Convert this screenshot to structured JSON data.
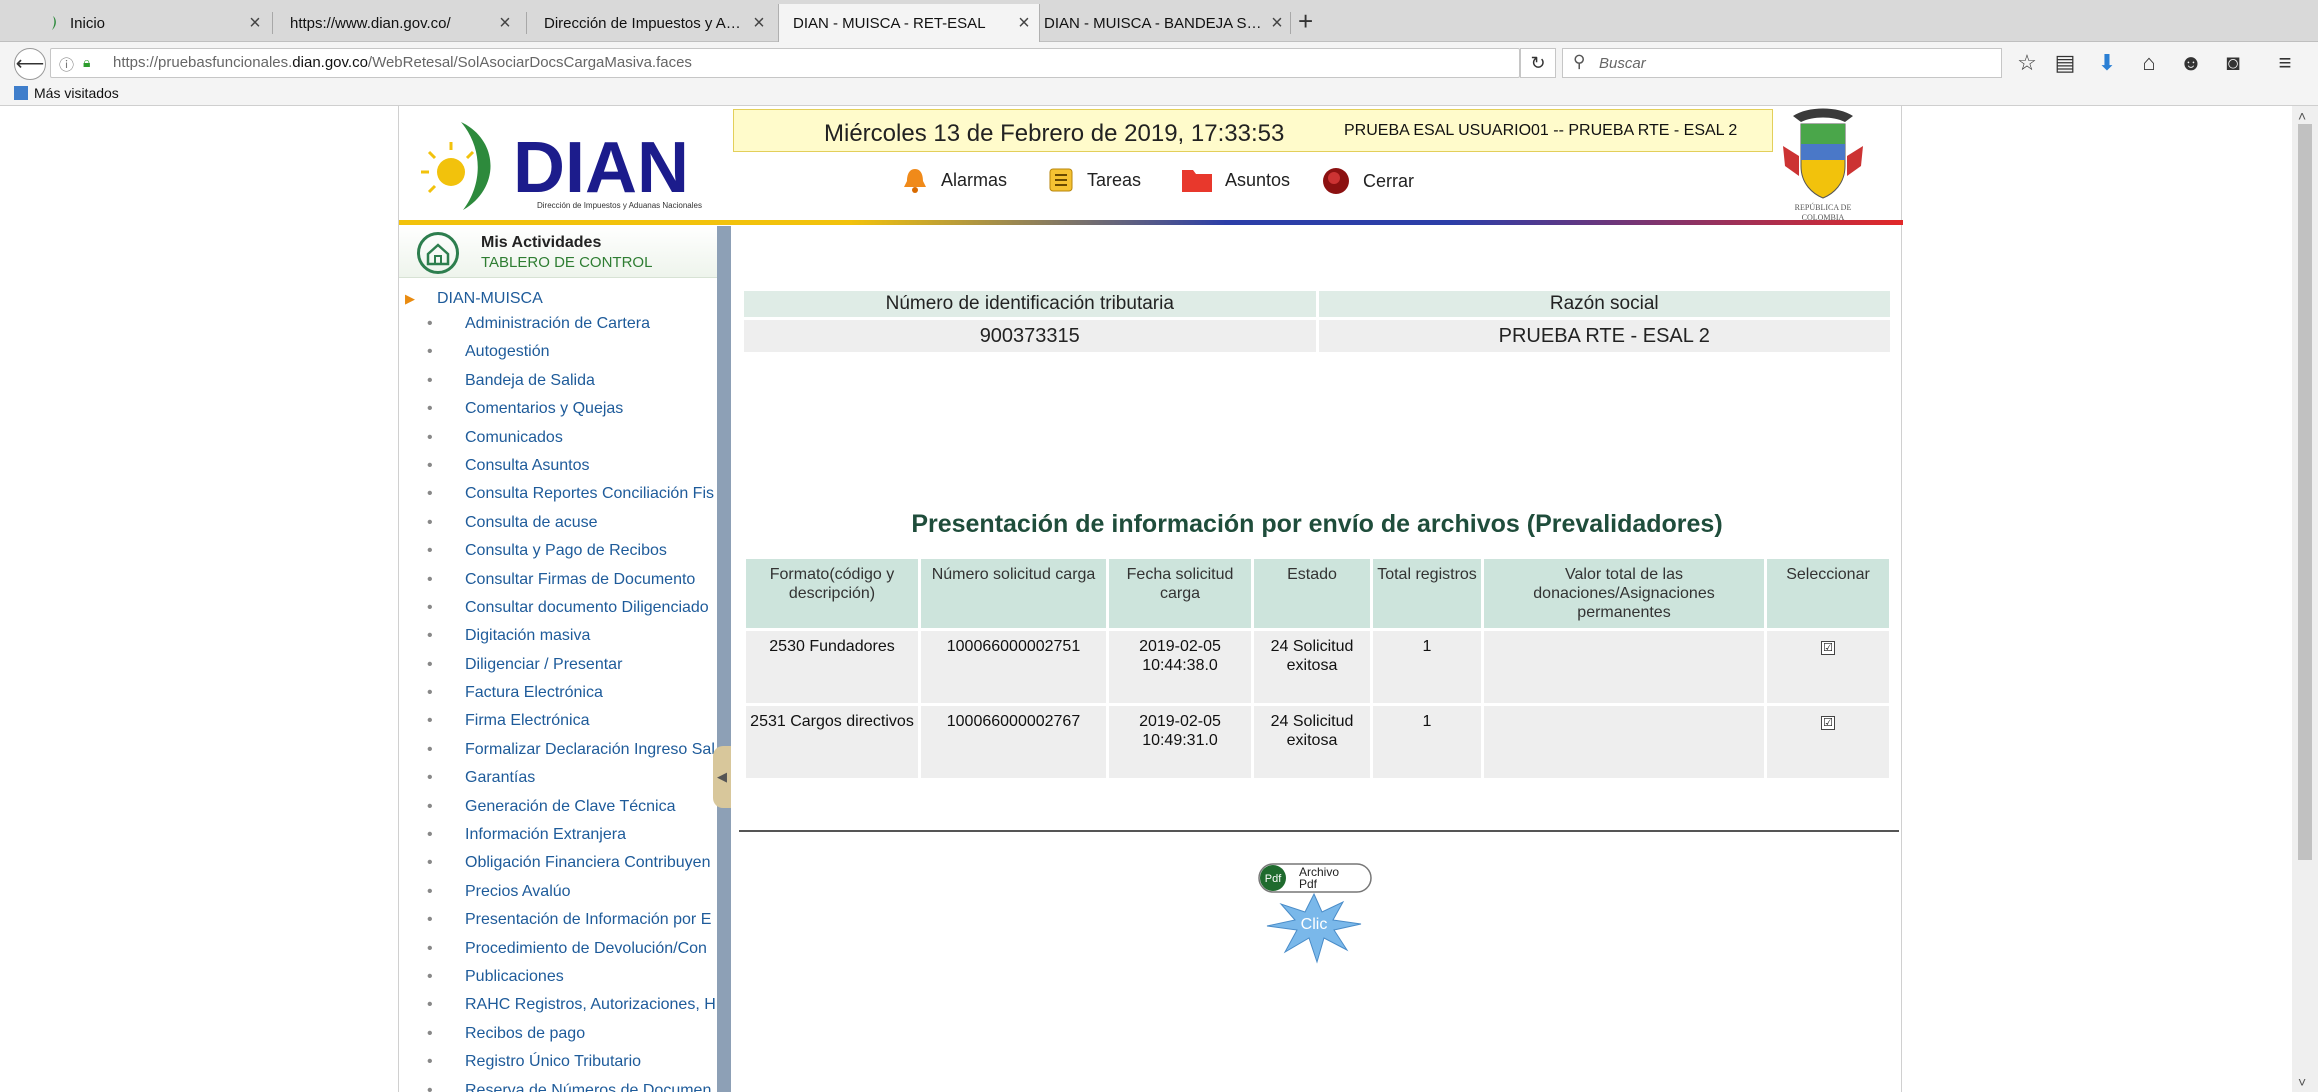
{
  "browser": {
    "tabs": [
      {
        "title": "Inicio",
        "active": false
      },
      {
        "title": "https://www.dian.gov.co/",
        "active": false
      },
      {
        "title": "Dirección de Impuestos y Adu...",
        "active": false
      },
      {
        "title": "DIAN - MUISCA - RET-ESAL",
        "active": true
      },
      {
        "title": "DIAN - MUISCA - BANDEJA SA...",
        "active": false
      }
    ],
    "new_tab": "+",
    "url_prefix": "https://pruebasfuncionales.",
    "url_domain": "dian.gov.co",
    "url_path": "/WebRetesal/SolAsociarDocsCargaMasiva.faces",
    "search_placeholder": "Buscar",
    "bookmark": "Más visitados"
  },
  "header": {
    "logo_text": "DIAN",
    "logo_subtitle": "Dirección de Impuestos y Aduanas Nacionales",
    "datetime": "Miércoles 13 de Febrero de 2019, 17:33:53",
    "user": "PRUEBA ESAL USUARIO01 -- PRUEBA RTE - ESAL 2",
    "links": {
      "alarmas": "Alarmas",
      "tareas": "Tareas",
      "asuntos": "Asuntos",
      "cerrar": "Cerrar"
    },
    "shield_caption_1": "REPÚBLICA DE",
    "shield_caption_2": "COLOMBIA"
  },
  "sidebar": {
    "title": "Mis Actividades",
    "subtitle": "TABLERO DE CONTROL",
    "root": "DIAN-MUISCA",
    "items": [
      "Administración de Cartera",
      "Autogestión",
      "Bandeja de Salida",
      "Comentarios y Quejas",
      "Comunicados",
      "Consulta Asuntos",
      "Consulta Reportes Conciliación Fis",
      "Consulta de acuse",
      "Consulta y Pago de Recibos",
      "Consultar Firmas de Documento",
      "Consultar documento Diligenciado",
      "Digitación masiva",
      "Diligenciar / Presentar",
      "Factura Electrónica",
      "Firma Electrónica",
      "Formalizar Declaración Ingreso Sal",
      "Garantías",
      "Generación de Clave Técnica",
      "Información Extranjera",
      "Obligación Financiera Contribuyen",
      "Precios Avalúo",
      "Presentación de Información por E",
      "Procedimiento de Devolución/Con",
      "Publicaciones",
      "RAHC Registros, Autorizaciones, H",
      "Recibos de pago",
      "Registro Único Tributario",
      "Reserva de Números de Documen"
    ]
  },
  "identification": {
    "nit_label": "Número de identificación tributaria",
    "razon_label": "Razón social",
    "nit": "900373315",
    "razon": "PRUEBA RTE - ESAL 2"
  },
  "section_title": "Presentación de información por envío de archivos (Prevalidadores)",
  "table": {
    "headers": {
      "formato": "Formato(código y descripción)",
      "numero": "Número solicitud carga",
      "fecha": "Fecha solicitud carga",
      "estado": "Estado",
      "total": "Total registros",
      "valor": "Valor total de las donaciones/Asignaciones permanentes",
      "seleccionar": "Seleccionar"
    },
    "rows": [
      {
        "formato": "2530 Fundadores",
        "numero": "100066000002751",
        "fecha": "2019-02-05 10:44:38.0",
        "estado": "24 Solicitud exitosa",
        "total": "1",
        "valor": "",
        "checked": "☑"
      },
      {
        "formato": "2531 Cargos directivos",
        "numero": "100066000002767",
        "fecha": "2019-02-05 10:49:31.0",
        "estado": "24 Solicitud exitosa",
        "total": "1",
        "valor": "",
        "checked": "☑"
      }
    ]
  },
  "pdf_button": {
    "line1": "Archivo",
    "line2": "Pdf",
    "click": "Clic"
  }
}
